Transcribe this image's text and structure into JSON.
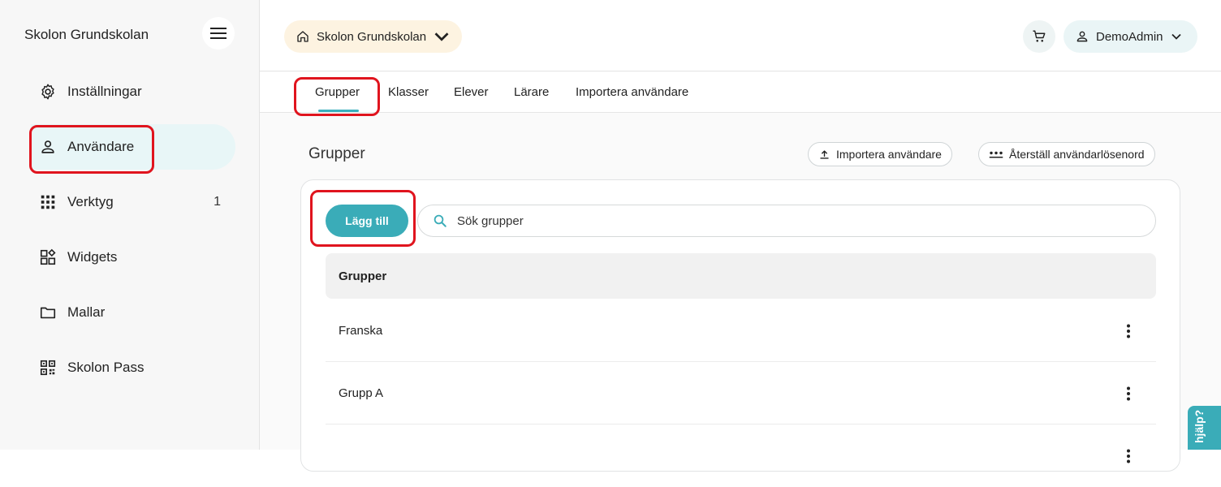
{
  "sidebar": {
    "school_name": "Skolon Grundskolan",
    "items": [
      {
        "label": "Inställningar",
        "icon": "gear-icon"
      },
      {
        "label": "Användare",
        "icon": "user-icon",
        "active": true
      },
      {
        "label": "Verktyg",
        "icon": "grid-icon",
        "count": "1"
      },
      {
        "label": "Widgets",
        "icon": "widgets-icon"
      },
      {
        "label": "Mallar",
        "icon": "folder-icon"
      },
      {
        "label": "Skolon Pass",
        "icon": "qr-code-icon"
      }
    ]
  },
  "header": {
    "school_selector": "Skolon Grundskolan",
    "user_name": "DemoAdmin"
  },
  "tabs": [
    {
      "label": "Grupper",
      "active": true
    },
    {
      "label": "Klasser"
    },
    {
      "label": "Elever"
    },
    {
      "label": "Lärare"
    },
    {
      "label": "Importera användare"
    }
  ],
  "main": {
    "title": "Grupper",
    "import_button": "Importera användare",
    "reset_password_button": "Återställ användarlösenord",
    "add_button": "Lägg till",
    "search_placeholder": "Sök grupper",
    "table_header": "Grupper",
    "rows": [
      "Franska",
      "Grupp A"
    ]
  },
  "help_tab": "hjälp?",
  "colors": {
    "accent": "#3aacb8",
    "highlight_box": "#e0141e",
    "school_chip_bg": "#fdf3e1",
    "active_nav_bg": "#e8f6f7"
  }
}
